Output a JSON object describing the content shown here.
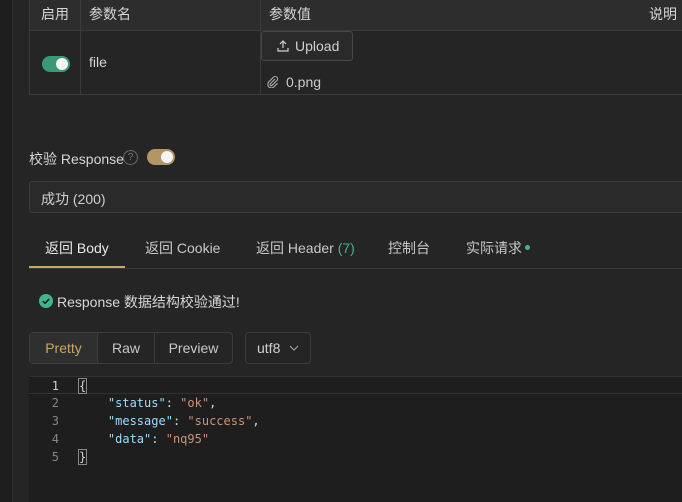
{
  "params": {
    "headers": [
      "启用",
      "参数名",
      "参数值",
      "说明"
    ],
    "row": {
      "enabled": true,
      "name": "file",
      "upload_label": "Upload",
      "file_name": "0.png"
    }
  },
  "validate": {
    "label": "校验 Response",
    "help_glyph": "?",
    "enabled": true
  },
  "response_select": {
    "value": "成功 (200)"
  },
  "tabs": [
    {
      "label": "返回 Body",
      "active": true
    },
    {
      "label": "返回 Cookie"
    },
    {
      "label": "返回 Header",
      "count": "(7)"
    },
    {
      "label": "控制台"
    },
    {
      "label": "实际请求",
      "dot": true
    }
  ],
  "validation_message": "Response 数据结构校验通过!",
  "view_modes": [
    "Pretty",
    "Raw",
    "Preview"
  ],
  "selected_view_mode": "Pretty",
  "encoding": "utf8",
  "code": {
    "line_numbers": [
      "1",
      "2",
      "3",
      "4",
      "5"
    ],
    "lines": [
      {
        "parts": [
          {
            "t": "{",
            "c": "brace"
          }
        ]
      },
      {
        "parts": [
          {
            "t": "    "
          },
          {
            "t": "\"status\"",
            "c": "k"
          },
          {
            "t": ": "
          },
          {
            "t": "\"ok\"",
            "c": "s"
          },
          {
            "t": ","
          }
        ]
      },
      {
        "parts": [
          {
            "t": "    "
          },
          {
            "t": "\"message\"",
            "c": "k"
          },
          {
            "t": ": "
          },
          {
            "t": "\"success\"",
            "c": "s"
          },
          {
            "t": ","
          }
        ]
      },
      {
        "parts": [
          {
            "t": "    "
          },
          {
            "t": "\"data\"",
            "c": "k"
          },
          {
            "t": ": "
          },
          {
            "t": "\"nq95\"",
            "c": "s"
          }
        ]
      },
      {
        "parts": [
          {
            "t": "}",
            "c": "brace"
          }
        ]
      }
    ]
  },
  "colors": {
    "background": "#252526",
    "accent_gold": "#c9a66b",
    "toggle_green": "#3a9a76",
    "toggle_gold": "#b39664",
    "success_green": "#3fb68b",
    "code_key": "#9cdcfe",
    "code_string": "#ce9178"
  }
}
